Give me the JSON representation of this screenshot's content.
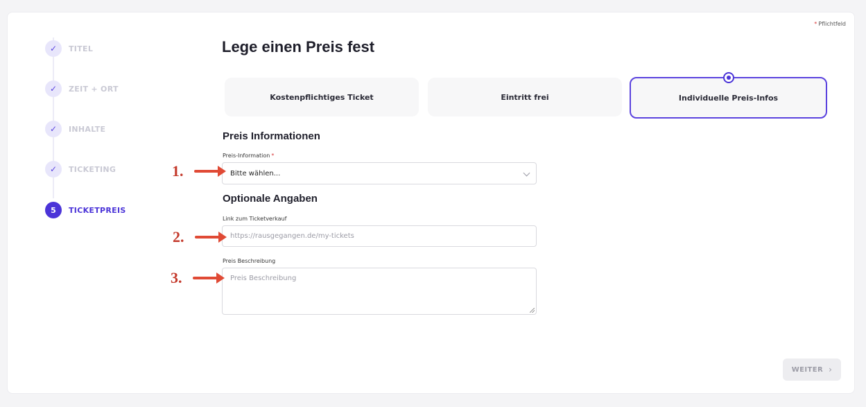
{
  "required_note": {
    "star": "*",
    "text": "Pflichtfeld"
  },
  "stepper": {
    "steps": [
      {
        "label": "TITEL",
        "marker": "✓",
        "state": "done"
      },
      {
        "label": "ZEIT + ORT",
        "marker": "✓",
        "state": "done"
      },
      {
        "label": "INHALTE",
        "marker": "✓",
        "state": "done"
      },
      {
        "label": "TICKETING",
        "marker": "✓",
        "state": "done"
      },
      {
        "label": "TICKETPREIS",
        "marker": "5",
        "state": "active"
      }
    ]
  },
  "main": {
    "title": "Lege einen Preis fest",
    "options": [
      {
        "label": "Kostenpflichtiges Ticket",
        "selected": false
      },
      {
        "label": "Eintritt frei",
        "selected": false
      },
      {
        "label": "Individuelle Preis-Infos",
        "selected": true
      }
    ],
    "section_price": "Preis Informationen",
    "price_info": {
      "label": "Preis-Information",
      "required_star": "*",
      "value": "Bitte wählen..."
    },
    "section_optional": "Optionale Angaben",
    "ticket_link": {
      "label": "Link zum Ticketverkauf",
      "placeholder": "https://rausgegangen.de/my-tickets"
    },
    "price_description": {
      "label": "Preis Beschreibung",
      "placeholder": "Preis Beschreibung"
    }
  },
  "annotations": [
    "1.",
    "2.",
    "3."
  ],
  "footer": {
    "next_label": "WEITER",
    "next_chevron": "›"
  },
  "colors": {
    "accent": "#4b34d8",
    "annotation": "#e04a35",
    "required": "#d9383a"
  }
}
